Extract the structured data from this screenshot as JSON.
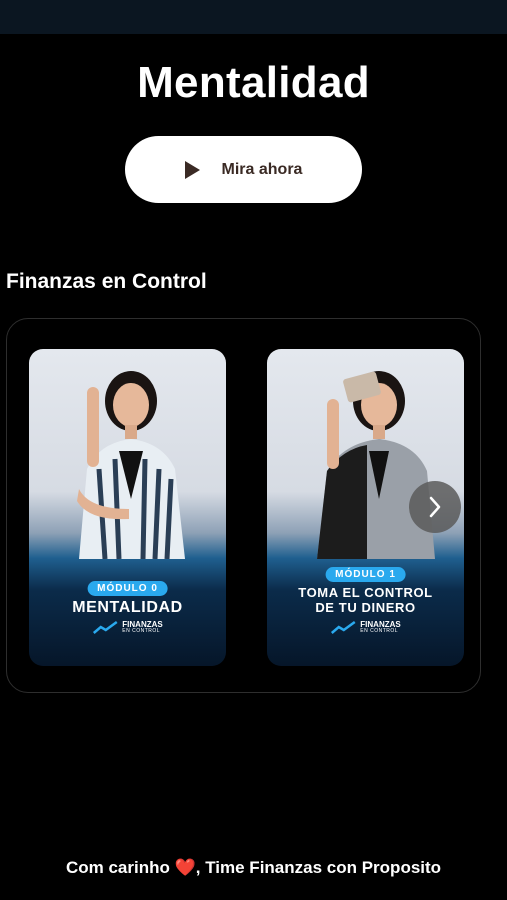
{
  "hero": {
    "title": "Mentalidad",
    "cta_label": "Mira ahora"
  },
  "section": {
    "title": "Finanzas en Control"
  },
  "cards": [
    {
      "badge": "MÓDULO 0",
      "title_line1": "MENTALIDAD",
      "title_line2": "",
      "logo_line1": "FINANZAS",
      "logo_line2": "EN CONTROL"
    },
    {
      "badge": "MÓDULO 1",
      "title_line1": "TOMA EL CONTROL",
      "title_line2": "DE TU DINERO",
      "logo_line1": "FINANZAS",
      "logo_line2": "EN CONTROL"
    }
  ],
  "footer": {
    "prefix": "Com carinho",
    "heart": "❤️",
    "suffix": ", Time Finanzas con Proposito"
  },
  "colors": {
    "accent_badge": "#2aa9ee",
    "cta_text": "#3a2a24",
    "background": "#000000"
  }
}
